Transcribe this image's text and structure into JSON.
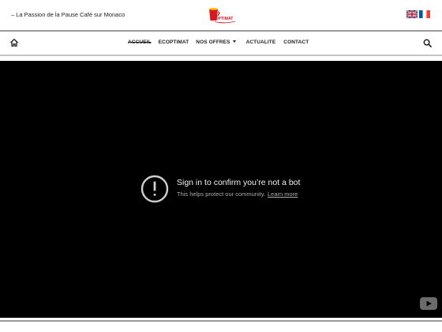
{
  "header": {
    "tagline": "– La Passion de la Pause Café sur Monaco",
    "logo_text": "OPTIMAT",
    "languages": [
      {
        "name": "English",
        "icon": "flag-uk-icon"
      },
      {
        "name": "Français",
        "icon": "flag-fr-icon"
      }
    ]
  },
  "nav": {
    "home_icon": "home-icon",
    "items": [
      {
        "label": "ACCUEIL",
        "active": true
      },
      {
        "label": "ECOPTIMAT",
        "active": false
      },
      {
        "label": "NOS OFFRES",
        "active": false,
        "dropdown": true
      },
      {
        "label": "ACTUALITE",
        "active": false
      },
      {
        "label": "CONTACT",
        "active": false
      }
    ],
    "search_icon": "search-icon"
  },
  "video": {
    "title": "Sign in to confirm you’re not a bot",
    "subtitle": "This helps protect our community.",
    "learn_more": "Learn more",
    "warning_icon": "exclamation-circle-icon",
    "brand_icon": "youtube-logo-icon"
  },
  "colors": {
    "header_bg": "#ffffff",
    "text": "#222222",
    "player_bg": "#000000",
    "logo_red": "#d71920",
    "logo_yellow": "#f7c600"
  }
}
